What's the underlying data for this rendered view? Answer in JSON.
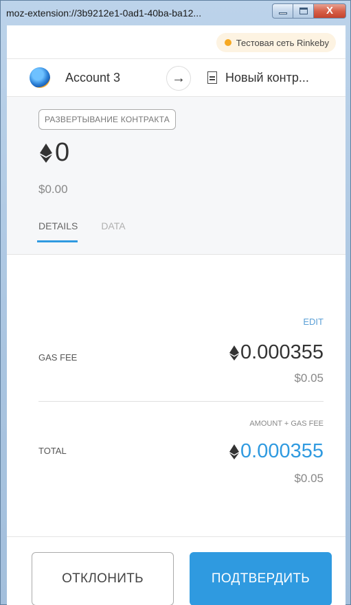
{
  "window": {
    "title": "moz-extension://3b9212e1-0ad1-40ba-ba12...",
    "close_glyph": "X"
  },
  "network": {
    "label": "Тестовая сеть Rinkeby",
    "dot_color": "#f6a821"
  },
  "account": {
    "name": "Account 3",
    "arrow_glyph": "→",
    "destination_label": "Новый контр..."
  },
  "summary": {
    "badge": "РАЗВЕРТЫВАНИЕ КОНТРАКТА",
    "amount": "0",
    "fiat": "$0.00",
    "tabs": [
      {
        "label": "DETAILS",
        "active": true
      },
      {
        "label": "DATA",
        "active": false
      }
    ]
  },
  "details": {
    "edit_label": "EDIT",
    "gas_fee": {
      "label": "GAS FEE",
      "value": "0.000355",
      "fiat": "$0.05"
    },
    "total": {
      "sublabel": "AMOUNT + GAS FEE",
      "label": "TOTAL",
      "value": "0.000355",
      "fiat": "$0.05"
    }
  },
  "footer": {
    "reject_label": "ОТКЛОНИТЬ",
    "confirm_label": "ПОДТВЕРДИТЬ"
  },
  "colors": {
    "accent": "#2f9ae0",
    "network_badge_bg": "#fdf3e2"
  }
}
